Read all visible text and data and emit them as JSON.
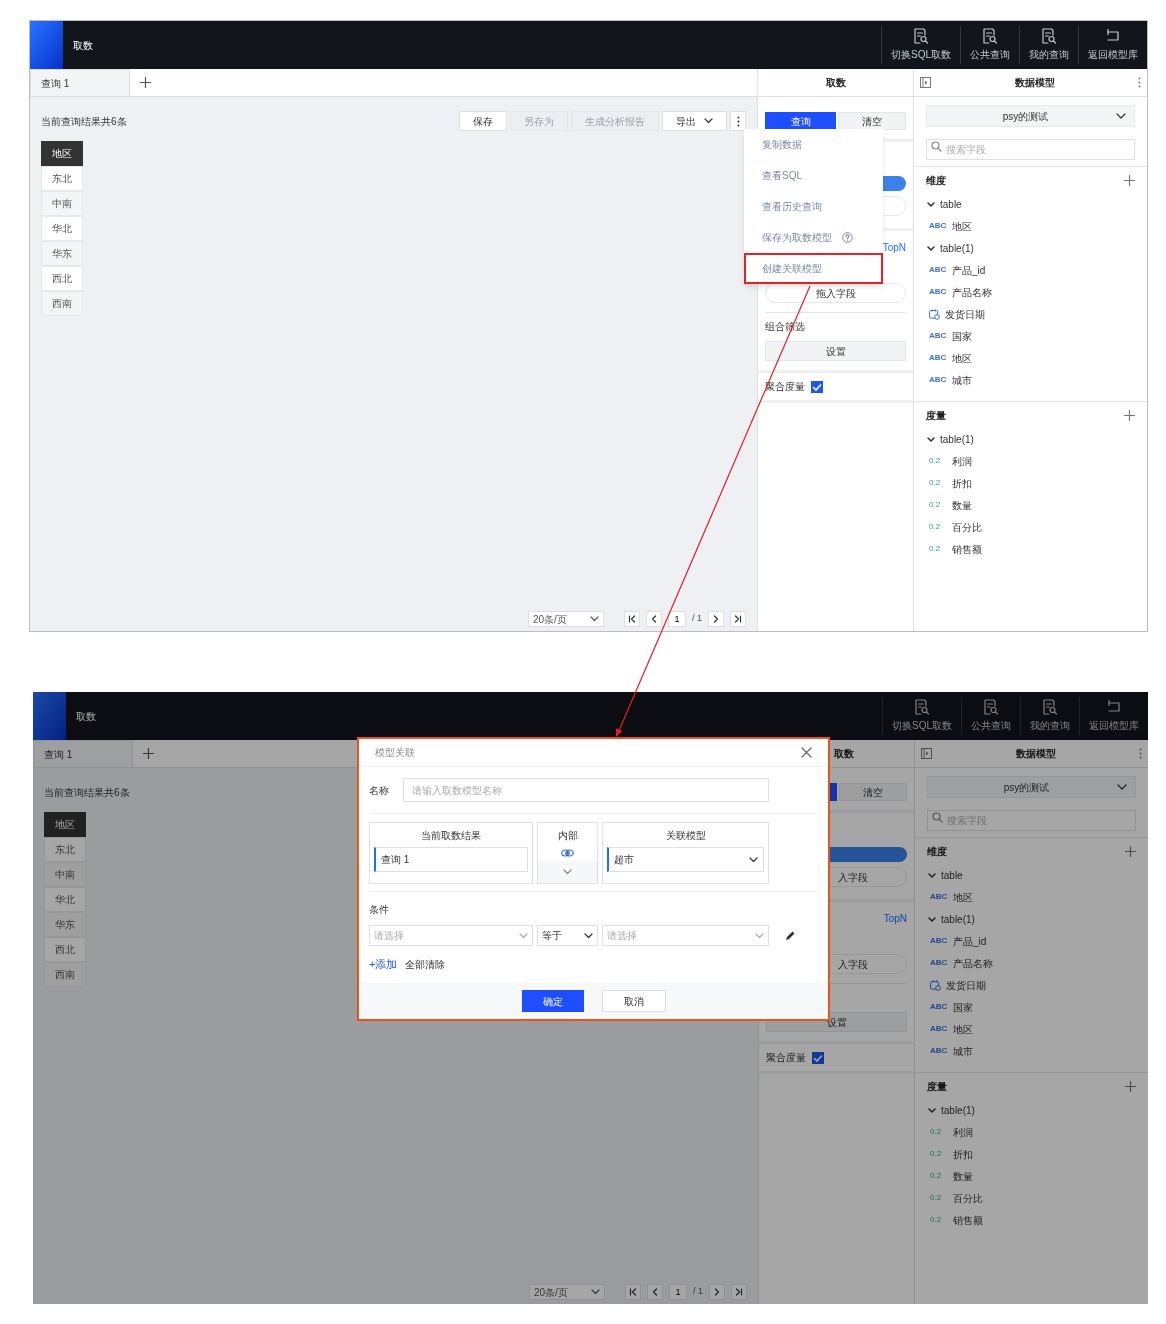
{
  "screens": [
    {
      "header": {
        "title": "取数",
        "nav": [
          {
            "label": "切换SQL取数"
          },
          {
            "label": "公共查询"
          },
          {
            "label": "我的查询"
          },
          {
            "label": "返回模型库"
          }
        ]
      },
      "tabs": [
        {
          "label": "查询 1",
          "selected": true
        }
      ],
      "summary": "当前查询结果共6条",
      "toolbar": [
        {
          "label": "保存",
          "disabled": false,
          "dropdown": false
        },
        {
          "label": "另存为",
          "disabled": true,
          "dropdown": false
        },
        {
          "label": "生成分析报告",
          "disabled": true,
          "dropdown": false
        },
        {
          "label": "导出",
          "disabled": false,
          "dropdown": true
        }
      ],
      "more_menu": [
        {
          "label": "复制数据",
          "help": false,
          "highlighted": false
        },
        {
          "label": "查看SQL",
          "help": false,
          "highlighted": false
        },
        {
          "label": "查看历史查询",
          "help": false,
          "highlighted": false
        },
        {
          "label": "保存为取数模型",
          "help": true,
          "highlighted": false
        },
        {
          "label": "创建关联模型",
          "help": false,
          "highlighted": true
        }
      ],
      "table": {
        "columns": [
          "地区"
        ],
        "rows": [
          [
            "东北"
          ],
          [
            "中南"
          ],
          [
            "华北"
          ],
          [
            "华东"
          ],
          [
            "西北"
          ],
          [
            "西南"
          ]
        ]
      },
      "pagination": {
        "page_size": "20条/页",
        "page": "1",
        "total": "/ 1"
      },
      "query_panel": {
        "title": "取数",
        "buttons": [
          {
            "label": "查询",
            "kind": "primary"
          },
          {
            "label": "清空",
            "kind": "default"
          }
        ],
        "dimension_zone": [
          {
            "kind": "active"
          },
          {
            "kind": "empty"
          }
        ],
        "topn": "TopN",
        "measure_zone": {
          "label": "拖入字段"
        },
        "filter_label": "组合筛选",
        "settings_button": "设置",
        "aggregate": {
          "label": "聚合度量",
          "checked": true
        }
      },
      "model_panel": {
        "title": "数据模型",
        "select": "psy的测试",
        "search_placeholder": "搜索字段",
        "sections": [
          {
            "title": "维度",
            "groups": [
              {
                "label": "table",
                "expanded": true,
                "children": [
                  {
                    "kind": "text",
                    "badge": "ABC",
                    "label": "地区"
                  }
                ]
              },
              {
                "label": "table(1)",
                "expanded": true,
                "children": [
                  {
                    "kind": "text",
                    "badge": "ABC",
                    "label": "产品_id"
                  },
                  {
                    "kind": "text",
                    "badge": "ABC",
                    "label": "产品名称"
                  },
                  {
                    "kind": "date",
                    "label": "发货日期"
                  },
                  {
                    "kind": "text",
                    "badge": "ABC",
                    "label": "国家"
                  },
                  {
                    "kind": "text",
                    "badge": "ABC",
                    "label": "地区"
                  },
                  {
                    "kind": "text",
                    "badge": "ABC",
                    "label": "城市"
                  }
                ]
              }
            ]
          },
          {
            "title": "度量",
            "groups": [
              {
                "label": "table(1)",
                "expanded": true,
                "children": [
                  {
                    "kind": "number",
                    "badge": "0.2",
                    "label": "利润"
                  },
                  {
                    "kind": "number",
                    "badge": "0.2",
                    "label": "折扣"
                  },
                  {
                    "kind": "number",
                    "badge": "0.2",
                    "label": "数量"
                  },
                  {
                    "kind": "number",
                    "badge": "0.2",
                    "label": "百分比"
                  },
                  {
                    "kind": "number",
                    "badge": "0.2",
                    "label": "销售额"
                  }
                ]
              }
            ]
          }
        ]
      }
    },
    {
      "dimmed": true,
      "header": {
        "title": "取数",
        "nav": [
          {
            "label": "切换SQL取数"
          },
          {
            "label": "公共查询"
          },
          {
            "label": "我的查询"
          },
          {
            "label": "返回模型库"
          }
        ]
      },
      "tabs": [
        {
          "label": "查询 1",
          "selected": true
        }
      ],
      "summary": "当前查询结果共6条",
      "table": {
        "columns": [
          "地区"
        ],
        "rows": [
          [
            "东北"
          ],
          [
            "中南"
          ],
          [
            "华北"
          ],
          [
            "华东"
          ],
          [
            "西北"
          ],
          [
            "西南"
          ]
        ]
      },
      "pagination": {
        "page_size": "20条/页",
        "page": "1",
        "total": "/ 1"
      },
      "query_panel": {
        "title": "取数",
        "buttons": [
          {
            "kind": "primary"
          },
          {
            "label": "清空",
            "kind": "default"
          }
        ],
        "dimension_zone": [
          {
            "kind": "active"
          },
          {
            "kind": "empty",
            "label": "入字段"
          }
        ],
        "topn": "TopN",
        "measure_zone": {
          "label": "入字段"
        },
        "settings_button": "设置",
        "aggregate": {
          "label": "聚合度量",
          "checked": true
        }
      },
      "model_panel": {
        "title": "数据模型",
        "select": "psy的测试",
        "search_placeholder": "搜索字段",
        "sections": [
          {
            "title": "维度",
            "groups": [
              {
                "label": "table",
                "expanded": true,
                "children": [
                  {
                    "kind": "text",
                    "badge": "ABC",
                    "label": "地区"
                  }
                ]
              },
              {
                "label": "table(1)",
                "expanded": true,
                "children": [
                  {
                    "kind": "text",
                    "badge": "ABC",
                    "label": "产品_id"
                  },
                  {
                    "kind": "text",
                    "badge": "ABC",
                    "label": "产品名称"
                  },
                  {
                    "kind": "date",
                    "label": "发货日期"
                  },
                  {
                    "kind": "text",
                    "badge": "ABC",
                    "label": "国家"
                  },
                  {
                    "kind": "text",
                    "badge": "ABC",
                    "label": "地区"
                  },
                  {
                    "kind": "text",
                    "badge": "ABC",
                    "label": "城市"
                  }
                ]
              }
            ]
          },
          {
            "title": "度量",
            "groups": [
              {
                "label": "table(1)",
                "expanded": true,
                "children": [
                  {
                    "kind": "number",
                    "badge": "0.2",
                    "label": "利润"
                  },
                  {
                    "kind": "number",
                    "badge": "0.2",
                    "label": "折扣"
                  },
                  {
                    "kind": "number",
                    "badge": "0.2",
                    "label": "数量"
                  },
                  {
                    "kind": "number",
                    "badge": "0.2",
                    "label": "百分比"
                  },
                  {
                    "kind": "number",
                    "badge": "0.2",
                    "label": "销售额"
                  }
                ]
              }
            ]
          }
        ]
      },
      "dialog": {
        "title": "模型关联",
        "highlighted": true,
        "name": {
          "label": "名称",
          "placeholder": "请输入取数模型名称"
        },
        "join": {
          "left": {
            "title": "当前取数结果",
            "value": "查询 1"
          },
          "type": {
            "title": "内部"
          },
          "right": {
            "title": "关联模型",
            "value": "超市"
          }
        },
        "condition": {
          "label": "条件",
          "fields": [
            {
              "placeholder": "请选择"
            },
            {
              "value": "等于"
            },
            {
              "placeholder": "请选择"
            }
          ]
        },
        "add_link": "+添加",
        "clear_link": "全部清除",
        "buttons": [
          {
            "label": "确定",
            "kind": "primary"
          },
          {
            "label": "取消",
            "kind": "default"
          }
        ]
      }
    }
  ]
}
